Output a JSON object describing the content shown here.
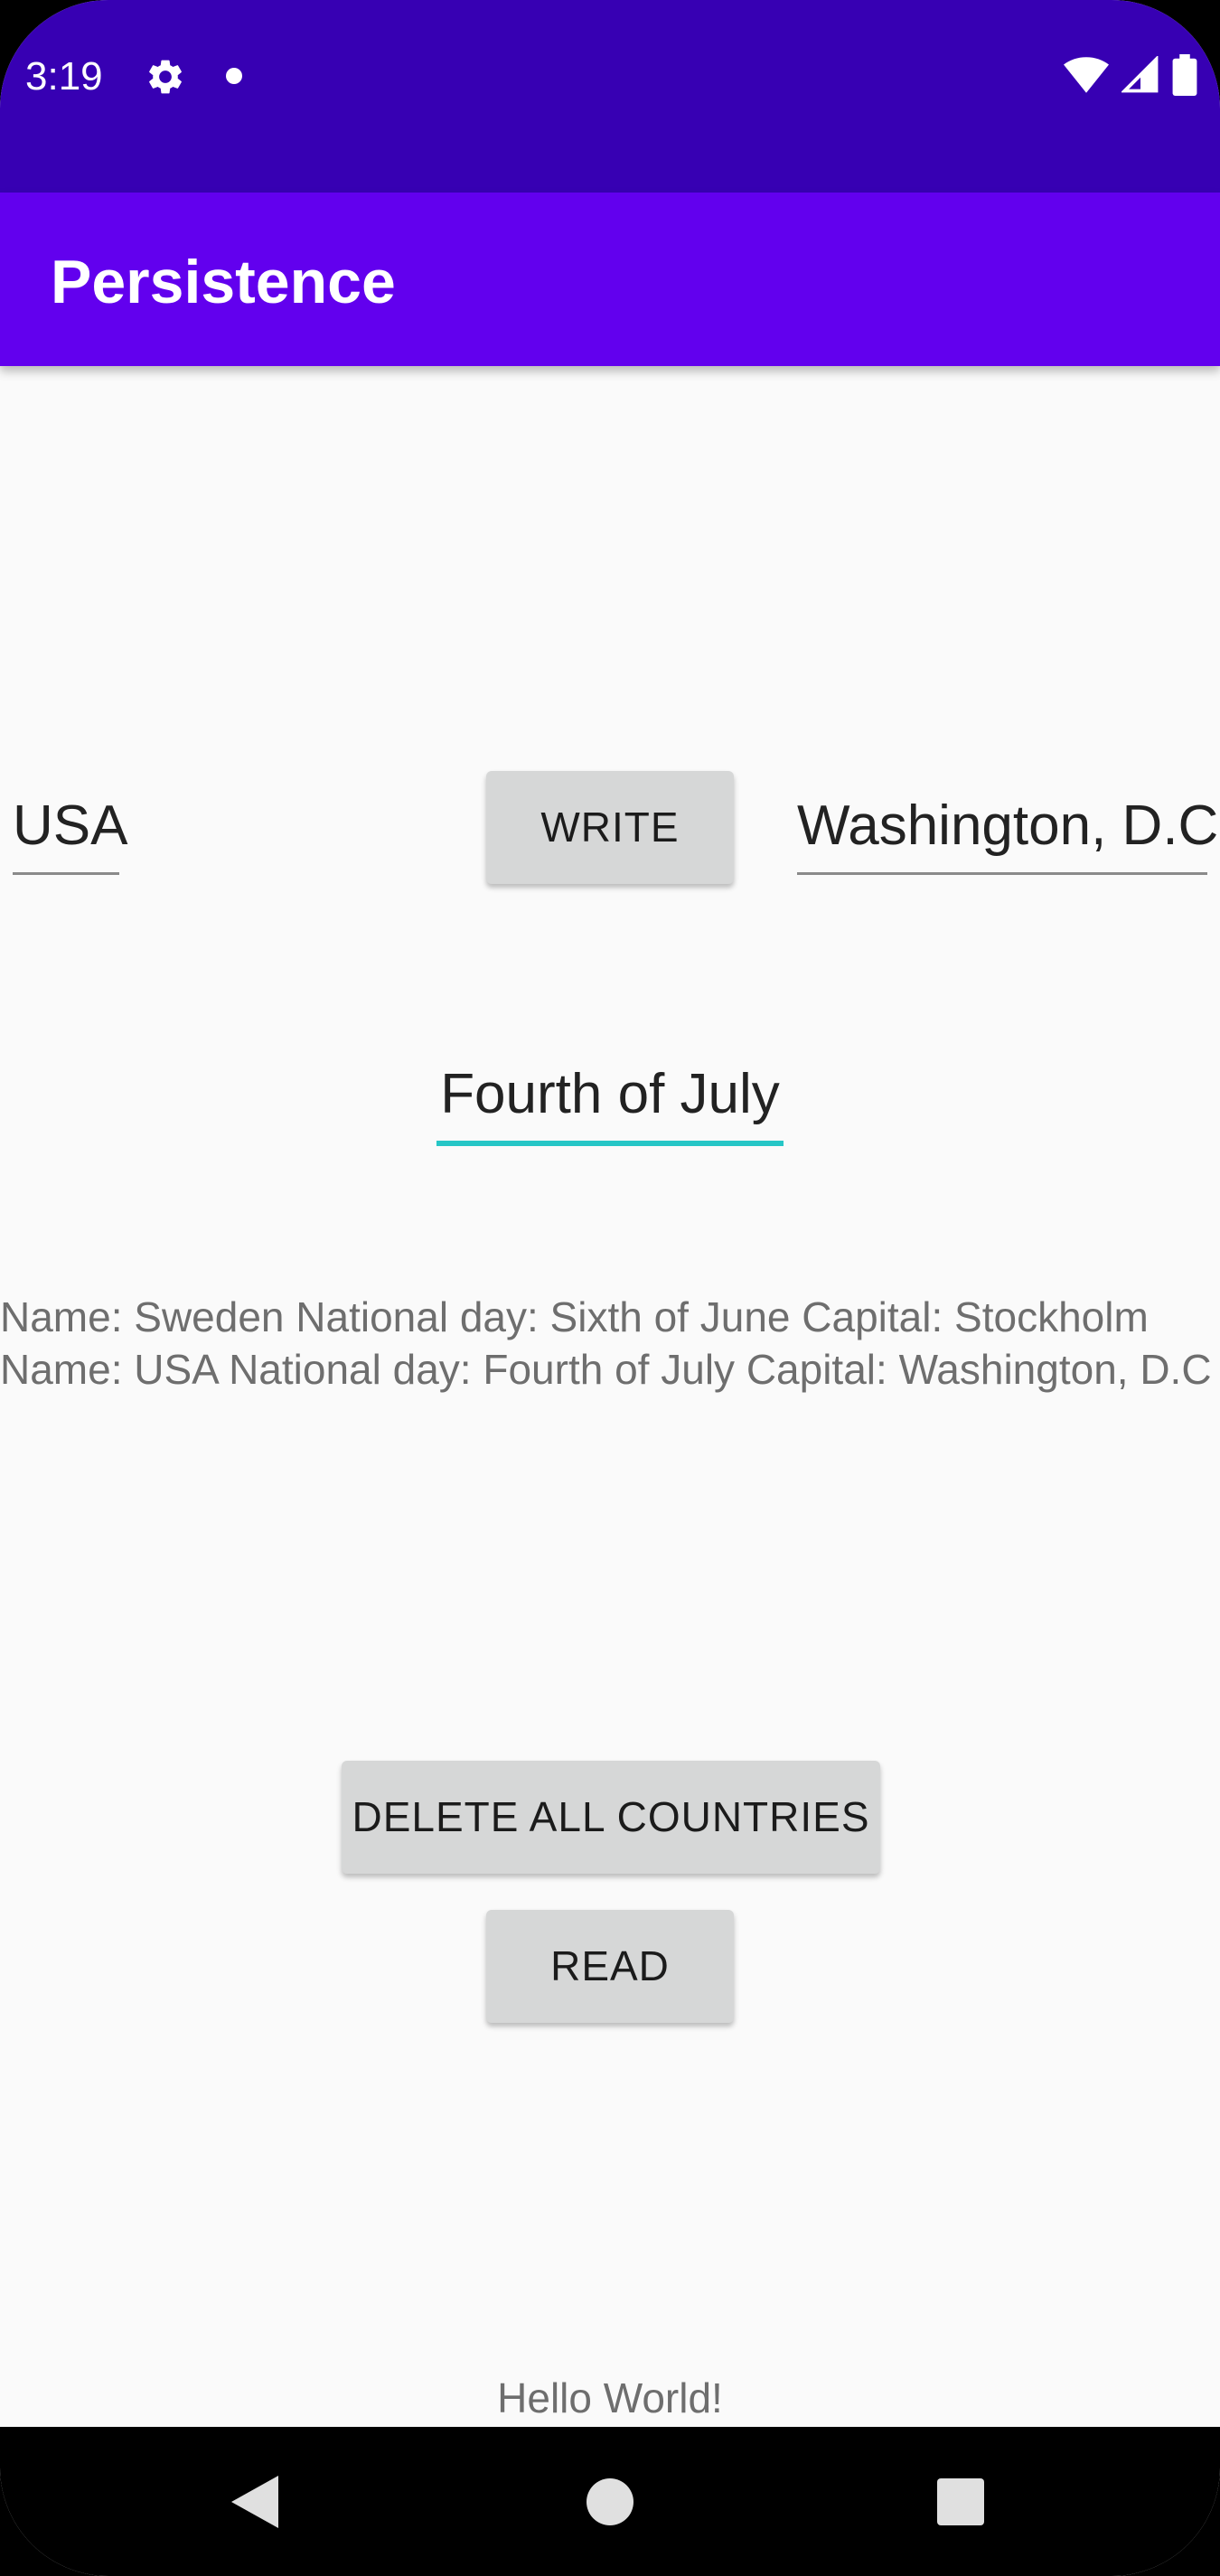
{
  "status_bar": {
    "time": "3:19",
    "icons": [
      "gear-icon",
      "notification-dot-icon",
      "wifi-icon",
      "signal-icon",
      "battery-icon"
    ]
  },
  "app_bar": {
    "title": "Persistence"
  },
  "form": {
    "country_name": "USA",
    "capital": "Washington, D.C",
    "national_day": "Fourth of July",
    "write_label": "WRITE"
  },
  "results": {
    "lines": [
      "Name: Sweden National day: Sixth of June Capital: Stockholm",
      "Name: USA National day: Fourth of July Capital: Washington, D.C"
    ]
  },
  "actions": {
    "delete_label": "DELETE ALL COUNTRIES",
    "read_label": "READ"
  },
  "footer": {
    "hello": "Hello World!"
  },
  "nav": {
    "icons": [
      "back-icon",
      "home-icon",
      "recents-icon"
    ]
  },
  "colors": {
    "status_bar": "#3700b3",
    "app_bar": "#6200ee",
    "focus_accent": "#26c6c6",
    "button": "#d6d7d7"
  }
}
